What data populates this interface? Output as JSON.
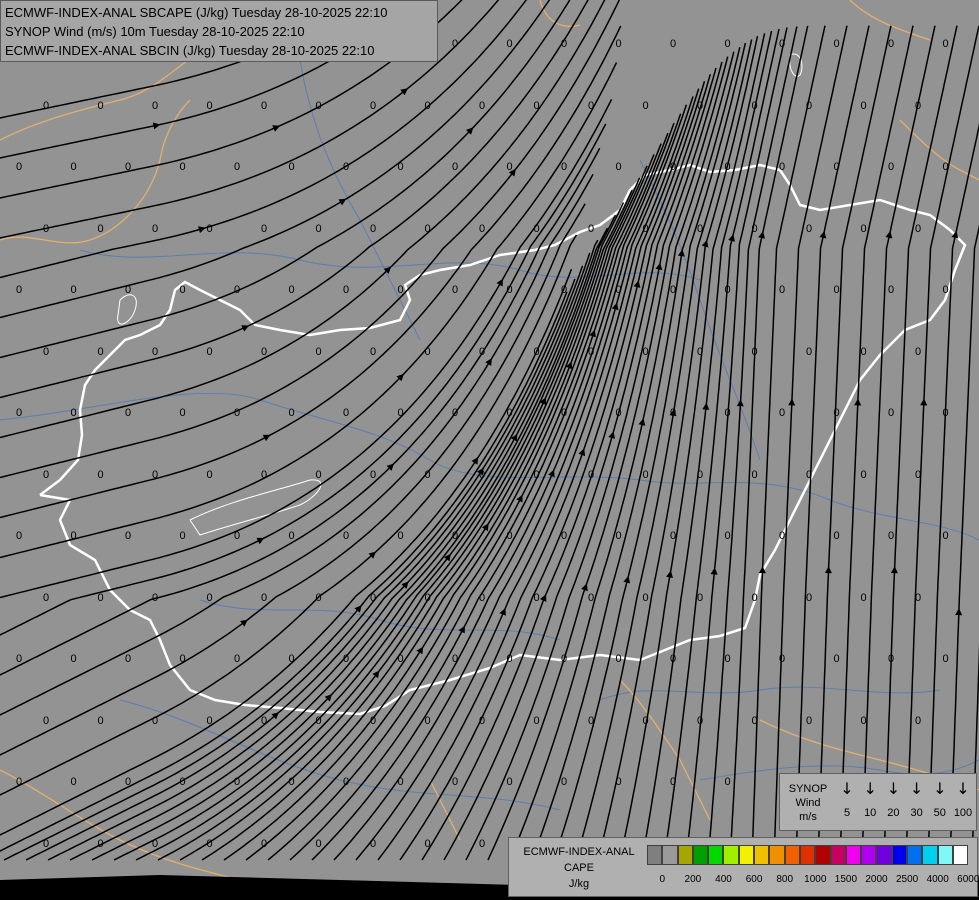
{
  "title": {
    "line1": "ECMWF-INDEX-ANAL SBCAPE (J/kg) Tuesday 28-10-2025 22:10",
    "line2": "SYNOP Wind (m/s) 10m Tuesday 28-10-2025 22:10",
    "line3": "ECMWF-INDEX-ANAL SBCIN (J/kg) Tuesday 28-10-2025 22:10"
  },
  "colors": {
    "background": "#939393",
    "border_highlight": "#ffffff",
    "borders_other": "#e0b070",
    "rivers": "#5a7fb0",
    "streamlines": "#000000"
  },
  "grid_value": "0",
  "synop_legend": {
    "title_line1": "SYNOP",
    "title_line2": "Wind",
    "title_line3": "m/s",
    "arrow_glyph": "↓",
    "items": [
      "5",
      "10",
      "20",
      "30",
      "50",
      "100"
    ]
  },
  "cape_legend": {
    "title_line1": "ECMWF-INDEX-ANAL",
    "title_line2": "CAPE",
    "title_line3": "J/kg",
    "swatches": [
      "#7f7f7f",
      "#9a9a9a",
      "#a6a600",
      "#00a000",
      "#00d800",
      "#a0f000",
      "#f0f000",
      "#f0c000",
      "#f09000",
      "#f06000",
      "#e03000",
      "#b00000",
      "#c80060",
      "#f000f0",
      "#b000f0",
      "#7000e0",
      "#0000f0",
      "#0070f0",
      "#00d0f0",
      "#80f8f8",
      "#ffffff"
    ],
    "tick_labels": [
      "0",
      "200",
      "400",
      "600",
      "800",
      "1000",
      "1500",
      "2000",
      "2500",
      "4000",
      "6000"
    ]
  }
}
